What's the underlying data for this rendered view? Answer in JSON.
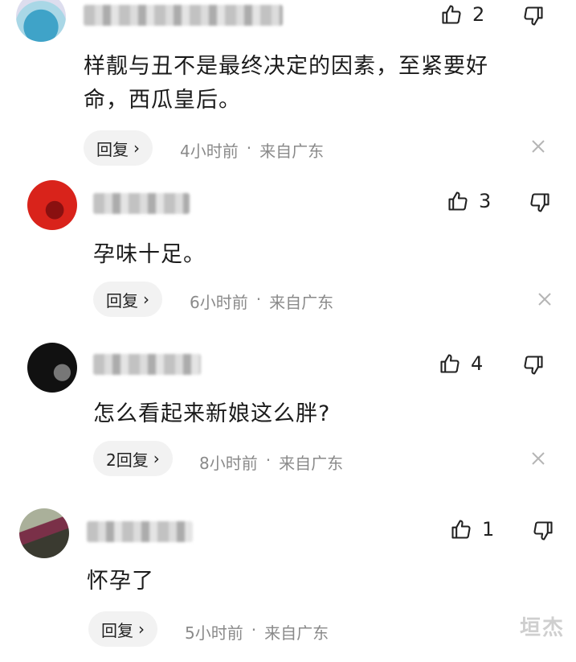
{
  "comments": [
    {
      "text": "样靓与丑不是最终决定的因素，至紧要好\n命，西瓜皇后。",
      "likes": "2",
      "reply_label": "回复",
      "time": "4小时前",
      "location": "来自广东",
      "avatar_color": "#7fb7c9"
    },
    {
      "text": "孕味十足。",
      "likes": "3",
      "reply_label": "回复",
      "time": "6小时前",
      "location": "来自广东",
      "avatar_color": "#d9231b"
    },
    {
      "text": "怎么看起来新娘这么胖?",
      "likes": "4",
      "reply_label": "2回复",
      "time": "8小时前",
      "location": "来自广东",
      "avatar_color": "#111111"
    },
    {
      "text": "怀孕了",
      "likes": "1",
      "reply_label": "回复",
      "time": "5小时前",
      "location": "来自广东",
      "avatar_color": "#5a5a4a"
    }
  ],
  "separator": "·",
  "watermark": "垣杰",
  "icons": {
    "like": "thumbs-up-icon",
    "dislike": "thumbs-down-icon",
    "close": "close-icon",
    "chevron": "chevron-right-icon"
  }
}
